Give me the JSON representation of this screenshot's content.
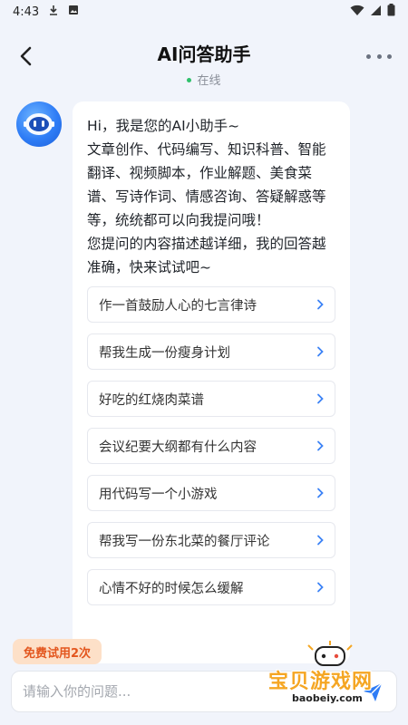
{
  "status": {
    "time": "4:43"
  },
  "header": {
    "title": "AI问答助手",
    "status": "在线"
  },
  "assistant": {
    "greeting": "Hi，我是您的AI小助手~\n文章创作、代码编写、知识科普、智能翻译、视频脚本，作业解题、美食菜谱、写诗作词、情感咨询、答疑解惑等等，统统都可以向我提问哦！\n您提问的内容描述越详细，我的回答越准确，快来试试吧~",
    "suggestions": [
      "作一首鼓励人心的七言律诗",
      "帮我生成一份瘦身计划",
      "好吃的红烧肉菜谱",
      "会议纪要大纲都有什么内容",
      "用代码写一个小游戏",
      "帮我写一份东北菜的餐厅评论",
      "心情不好的时候怎么缓解"
    ]
  },
  "trial_badge": "免费试用2次",
  "input": {
    "placeholder": "请输入你的问题..."
  },
  "watermark": {
    "name": "宝贝游戏网",
    "url": "baobeiy.com"
  },
  "colors": {
    "accent": "#2f7df6",
    "online": "#2fc16b",
    "badge_bg": "#fde0c8",
    "badge_text": "#e3561e"
  }
}
